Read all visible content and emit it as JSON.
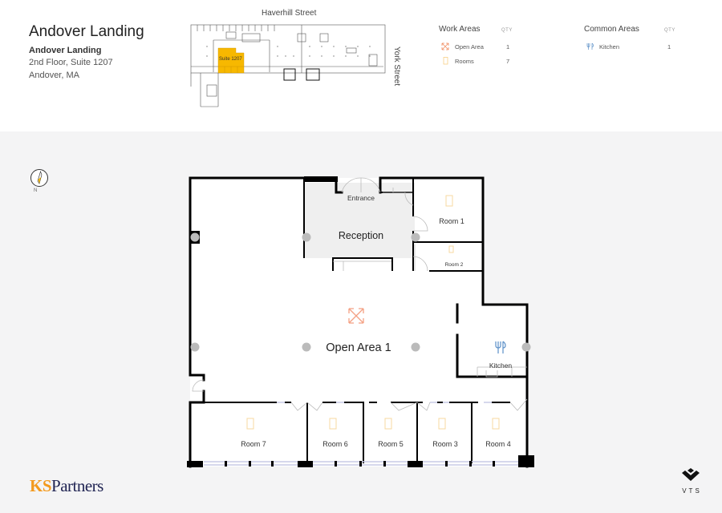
{
  "header": {
    "title": "Andover Landing",
    "building_name": "Andover Landing",
    "address_line1": "2nd Floor, Suite 1207",
    "address_line2": "Andover, MA"
  },
  "keyplan": {
    "street_top": "Haverhill Street",
    "street_right": "York Street",
    "suite_label": "Suite 1207",
    "highlight_color": "#f7b800"
  },
  "legend": {
    "qty_label": "QTY",
    "work_areas": {
      "title": "Work Areas",
      "items": [
        {
          "icon": "expand-arrows-icon",
          "label": "Open Area",
          "qty": "1",
          "color": "#f08a5d"
        },
        {
          "icon": "door-icon",
          "label": "Rooms",
          "qty": "7",
          "color": "#f7c873"
        }
      ]
    },
    "common_areas": {
      "title": "Common Areas",
      "items": [
        {
          "icon": "fork-knife-icon",
          "label": "Kitchen",
          "qty": "1",
          "color": "#5b8fc7"
        }
      ]
    }
  },
  "compass": {
    "label": "N"
  },
  "floorplan": {
    "rooms": {
      "entrance": "Entrance",
      "reception": "Reception",
      "open_area": "Open Area 1",
      "kitchen": "Kitchen",
      "room1": "Room 1",
      "room2": "Room 2",
      "room3": "Room 3",
      "room4": "Room 4",
      "room5": "Room 5",
      "room6": "Room 6",
      "room7": "Room 7"
    }
  },
  "footer": {
    "logo_ks": "KS",
    "logo_partners": "Partners",
    "vts_label": "VTS"
  }
}
